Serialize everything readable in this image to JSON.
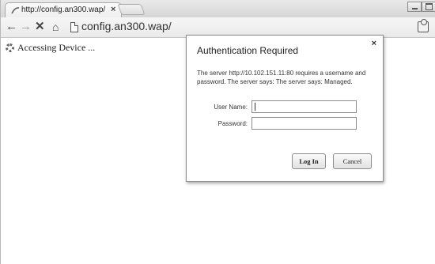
{
  "browser": {
    "tab_title": "http://config.an300.wap/",
    "tab_close": "×",
    "address": "config.an300.wap/",
    "nav": {
      "back": "←",
      "forward": "→",
      "reload": "✕",
      "home": "⌂"
    }
  },
  "page": {
    "status_text": "Accessing Device ..."
  },
  "dialog": {
    "title": "Authentication Required",
    "close": "×",
    "message": "The server http://10.102.151.11:80 requires a username and password. The server says: The server says: Managed.",
    "username_label": "User Name:",
    "username_value": "",
    "password_label": "Password:",
    "password_value": "",
    "login_label": "Log In",
    "cancel_label": "Cancel"
  }
}
